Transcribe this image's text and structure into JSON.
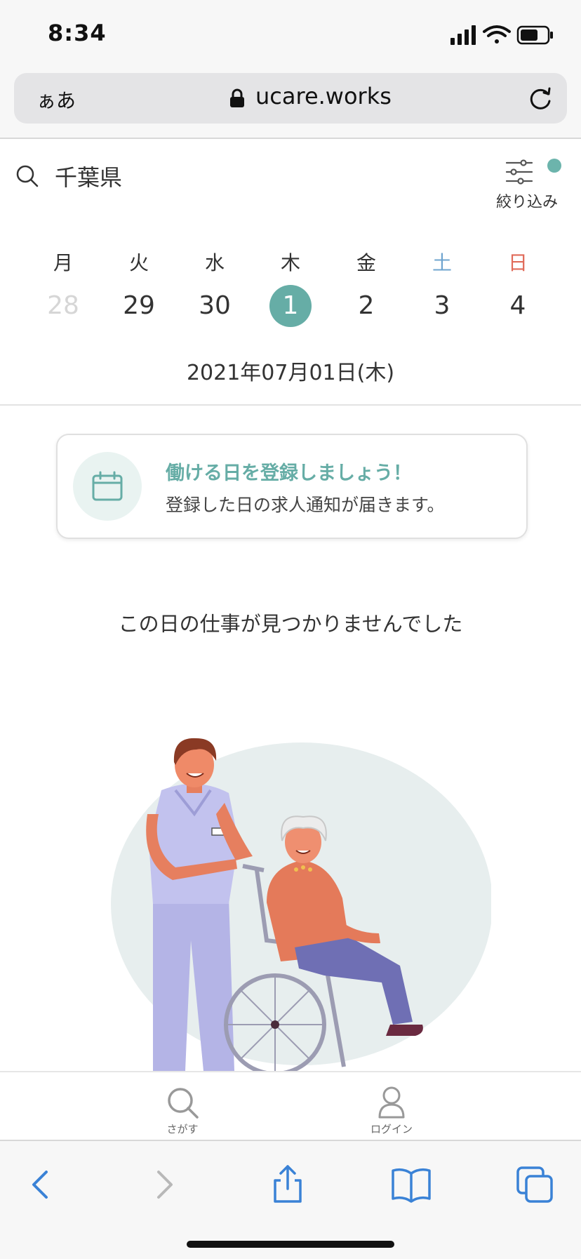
{
  "status_bar": {
    "time": "8:34"
  },
  "browser": {
    "text_size_label": "ぁあ",
    "domain": "ucare.works"
  },
  "search": {
    "query": "千葉県",
    "filter_label": "絞り込み"
  },
  "calendar": {
    "days": [
      {
        "dow": "月",
        "date": "28",
        "state": "past"
      },
      {
        "dow": "火",
        "date": "29",
        "state": "normal"
      },
      {
        "dow": "水",
        "date": "30",
        "state": "normal"
      },
      {
        "dow": "木",
        "date": "1",
        "state": "selected"
      },
      {
        "dow": "金",
        "date": "2",
        "state": "normal"
      },
      {
        "dow": "土",
        "date": "3",
        "state": "saturday"
      },
      {
        "dow": "日",
        "date": "4",
        "state": "sunday"
      }
    ],
    "selected_full": "2021年07月01日(木)"
  },
  "register_card": {
    "title": "働ける日を登録しましょう！",
    "description": "登録した日の求人通知が届きます。"
  },
  "empty_message": "この日の仕事が見つかりませんでした",
  "tab_bar": {
    "items": [
      {
        "label": "さがす",
        "icon": "search-icon"
      },
      {
        "label": "ログイン",
        "icon": "user-icon"
      }
    ]
  },
  "colors": {
    "accent": "#66ada6",
    "saturday": "#6fa4cf",
    "sunday": "#e06b5a",
    "ios_blue": "#3a82d6"
  }
}
